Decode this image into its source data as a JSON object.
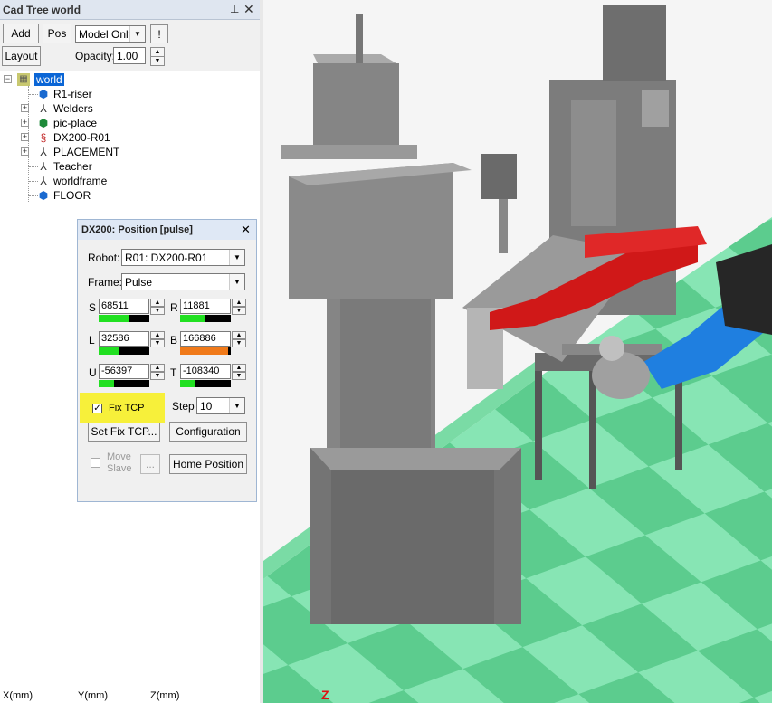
{
  "panel": {
    "title": "Cad Tree world",
    "pin_icon": "pin-icon",
    "close_icon": "close-icon"
  },
  "toolbar": {
    "add_label": "Add",
    "pos_label": "Pos",
    "view_mode": "Model Only",
    "bang_label": "!",
    "layout_label": "Layout",
    "opacity_label": "Opacity:",
    "opacity_value": "1.00"
  },
  "tree": {
    "items": [
      {
        "label": "world",
        "icon": "world-icon",
        "selected": true
      },
      {
        "label": "R1-riser",
        "icon": "part-icon"
      },
      {
        "label": "Welders",
        "icon": "frame-icon"
      },
      {
        "label": "pic-place",
        "icon": "part-icon"
      },
      {
        "label": "DX200-R01",
        "icon": "robot-icon"
      },
      {
        "label": "PLACEMENT",
        "icon": "frame-icon"
      },
      {
        "label": "Teacher",
        "icon": "frame-icon"
      },
      {
        "label": "worldframe",
        "icon": "frame-icon"
      },
      {
        "label": "FLOOR",
        "icon": "part-icon"
      }
    ]
  },
  "status": {
    "x_label": "X(mm)",
    "y_label": "Y(mm)",
    "z_label": "Z(mm)"
  },
  "dialog": {
    "title": "DX200: Position [pulse]",
    "robot_label": "Robot:",
    "robot_value": "R01: DX200-R01",
    "frame_label": "Frame:",
    "frame_value": "Pulse",
    "axes": [
      {
        "name": "S",
        "value": "68511",
        "fill_fraction": 0.6,
        "fill_color": "#21e021"
      },
      {
        "name": "R",
        "value": "11881",
        "fill_fraction": 0.5,
        "fill_color": "#21e021"
      },
      {
        "name": "L",
        "value": "32586",
        "fill_fraction": 0.4,
        "fill_color": "#21e021"
      },
      {
        "name": "B",
        "value": "166886",
        "fill_fraction": 0.95,
        "fill_color": "#f07a1a"
      },
      {
        "name": "U",
        "value": "-56397",
        "fill_fraction": 0.3,
        "fill_color": "#21e021"
      },
      {
        "name": "T",
        "value": "-108340",
        "fill_fraction": 0.3,
        "fill_color": "#21e021"
      }
    ],
    "fix_tcp_label": "Fix TCP",
    "fix_tcp_checked": true,
    "step_label": "Step",
    "step_value": "10",
    "set_fix_tcp_label": "Set Fix TCP...",
    "configuration_label": "Configuration",
    "move_slave_label": "Move Slave",
    "ellipsis_label": "...",
    "home_position_label": "Home Position"
  },
  "viewport": {
    "axis_indicator": "Z",
    "floor_color_a": "#87e5b4",
    "floor_color_b": "#5ccc8e",
    "sky_color": "#f5f5f5",
    "robot_color": "#1f7fe0",
    "part_color": "#d01818"
  }
}
